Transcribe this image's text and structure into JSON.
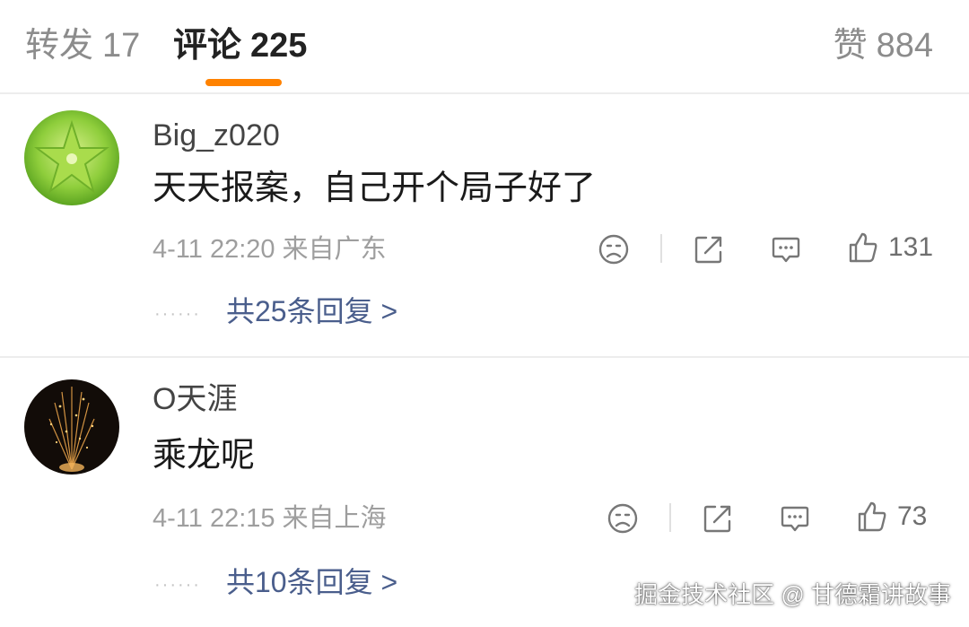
{
  "tabs": {
    "repost": {
      "label": "转发",
      "count": "17"
    },
    "comments": {
      "label": "评论",
      "count": "225"
    },
    "likes": {
      "label": "赞",
      "count": "884"
    },
    "accent_color": "#ff8200"
  },
  "comments": [
    {
      "username": "Big_z020",
      "text": "天天报案，自己开个局子好了",
      "time": "4-11 22:20",
      "location": "来自广东",
      "likes": "131",
      "replies_label": "共25条回复 >",
      "avatar": "star-fruit-image"
    },
    {
      "username": "O天涯",
      "text": "乘龙呢",
      "time": "4-11 22:15",
      "location": "来自上海",
      "likes": "73",
      "replies_label": "共10条回复 >",
      "avatar": "firework-image"
    }
  ],
  "icons": [
    "sad-face-icon",
    "share-icon",
    "comment-icon",
    "thumbs-up-icon"
  ],
  "watermark": "掘金技术社区 @ 甘德霜讲故事",
  "colors": {
    "reply_link": "#4a5e8c",
    "meta_text": "#9e9e9e"
  }
}
